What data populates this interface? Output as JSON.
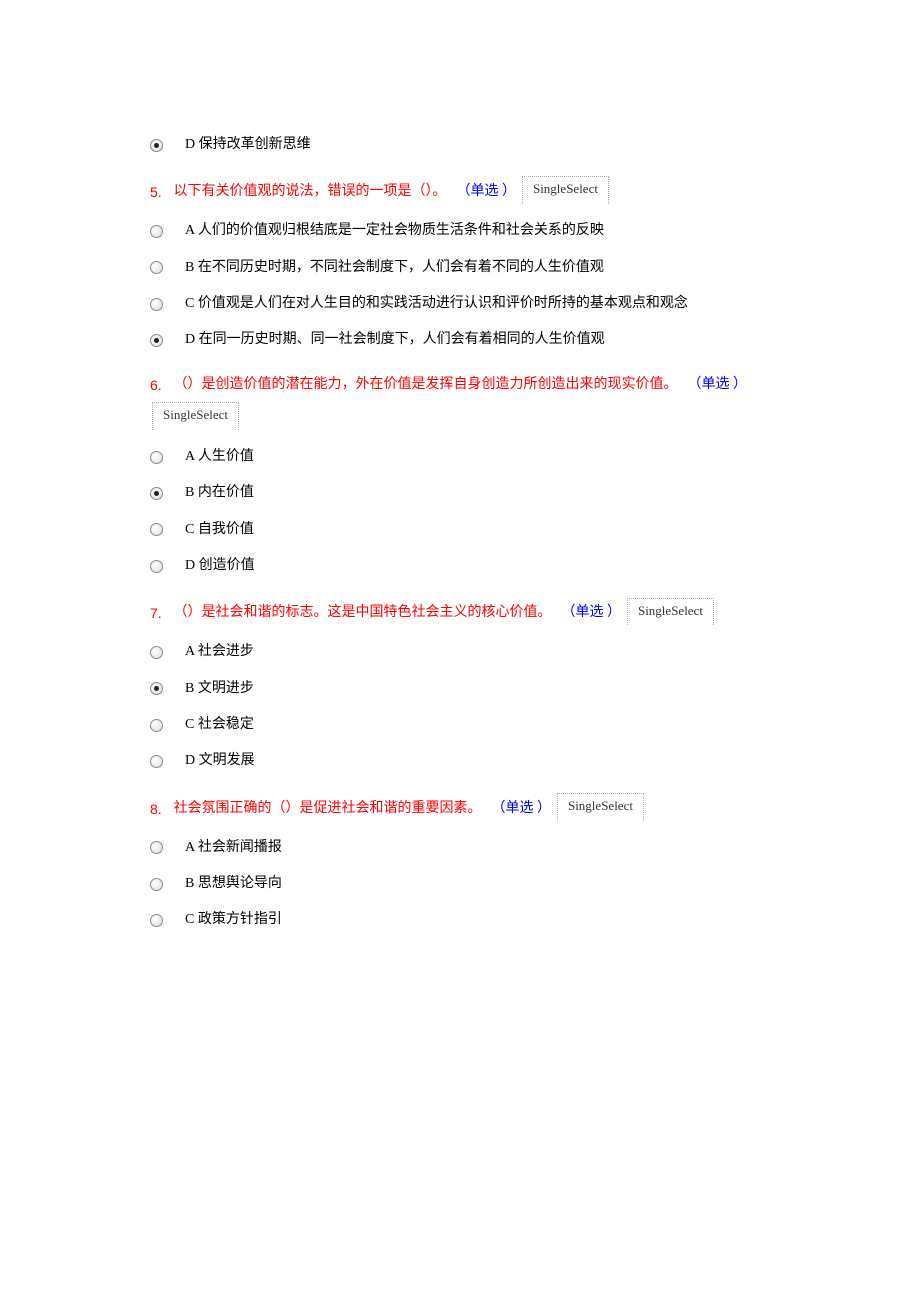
{
  "select_label": "SingleSelect",
  "questions": [
    {
      "number": null,
      "text": null,
      "type": null,
      "select_inline": false,
      "options": [
        {
          "label": "D 保持改革创新思维",
          "selected": true
        }
      ]
    },
    {
      "number": "5.  ",
      "text": "以下有关价值观的说法，错误的一项是（）。",
      "type": "（单选 ）",
      "select_inline": true,
      "options": [
        {
          "label": "A 人们的价值观归根结底是一定社会物质生活条件和社会关系的反映",
          "selected": false
        },
        {
          "label": "B 在不同历史时期，不同社会制度下，人们会有着不同的人生价值观",
          "selected": false
        },
        {
          "label": "C 价值观是人们在对人生目的和实践活动进行认识和评价时所持的基本观点和观念",
          "selected": false
        },
        {
          "label": "D 在同一历史时期、同一社会制度下，人们会有着相同的人生价值观",
          "selected": true
        }
      ]
    },
    {
      "number": "6.  ",
      "text": "（）是创造价值的潜在能力，外在价值是发挥自身创造力所创造出来的现实价值。",
      "type": "（单选 ）",
      "select_inline": false,
      "options": [
        {
          "label": "A 人生价值",
          "selected": false
        },
        {
          "label": "B 内在价值",
          "selected": true
        },
        {
          "label": "C 自我价值",
          "selected": false
        },
        {
          "label": "D 创造价值",
          "selected": false
        }
      ]
    },
    {
      "number": "7.  ",
      "text": "（）是社会和谐的标志。这是中国特色社会主义的核心价值。",
      "type": "（单选 ）",
      "select_inline": true,
      "options": [
        {
          "label": "A 社会进步",
          "selected": false
        },
        {
          "label": "B 文明进步",
          "selected": true
        },
        {
          "label": "C 社会稳定",
          "selected": false
        },
        {
          "label": "D 文明发展",
          "selected": false
        }
      ]
    },
    {
      "number": "8.  ",
      "text": "社会氛围正确的（）是促进社会和谐的重要因素。",
      "type": "（单选 ）",
      "select_inline": true,
      "options": [
        {
          "label": "A 社会新闻播报",
          "selected": false
        },
        {
          "label": "B 思想舆论导向",
          "selected": false
        },
        {
          "label": "C 政策方针指引",
          "selected": false
        }
      ]
    }
  ]
}
